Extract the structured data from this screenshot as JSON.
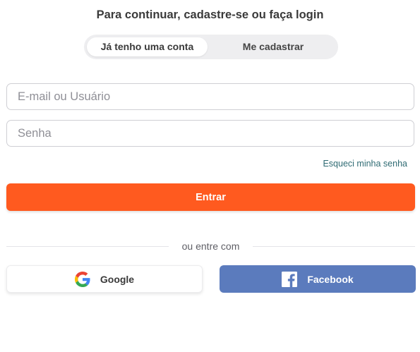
{
  "header": {
    "title": "Para continuar, cadastre-se ou faça login"
  },
  "tabs": [
    {
      "label": "Já tenho uma conta",
      "active": true
    },
    {
      "label": "Me cadastrar",
      "active": false
    }
  ],
  "form": {
    "email_placeholder": "E-mail ou Usuário",
    "email_value": "",
    "password_placeholder": "Senha",
    "password_value": "",
    "forgot_label": "Esqueci minha senha",
    "submit_label": "Entrar"
  },
  "divider": {
    "label": "ou entre com"
  },
  "social": {
    "google_label": "Google",
    "google_icon": "google-icon",
    "facebook_label": "Facebook",
    "facebook_icon": "facebook-icon"
  },
  "colors": {
    "accent": "#ff5a1f",
    "facebook": "#5b7bbd",
    "link": "#2f6b73"
  }
}
